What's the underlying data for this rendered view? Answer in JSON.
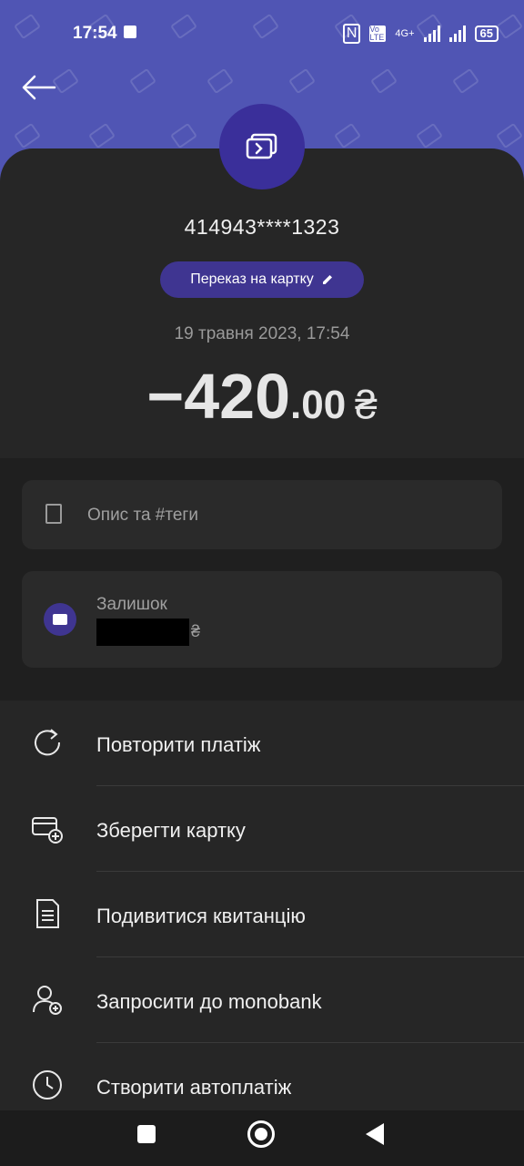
{
  "status_bar": {
    "time": "17:54",
    "network": "4G+",
    "volte": "Vo LTE",
    "battery": "65"
  },
  "transaction": {
    "card_number": "414943****1323",
    "type_label": "Переказ на картку",
    "date": "19 травня 2023, 17:54",
    "amount_main": "−420",
    "amount_cents": ".00",
    "currency": "₴"
  },
  "description": {
    "placeholder": "Опис та #теги"
  },
  "balance": {
    "label": "Залишок",
    "currency": "₴"
  },
  "actions": [
    {
      "label": "Повторити платіж",
      "icon": "repeat-icon"
    },
    {
      "label": "Зберегти картку",
      "icon": "add-card-icon"
    },
    {
      "label": "Подивитися квитанцію",
      "icon": "receipt-icon"
    },
    {
      "label": "Запросити до monobank",
      "icon": "invite-user-icon"
    },
    {
      "label": "Створити автоплатіж",
      "icon": "clock-icon"
    }
  ],
  "colors": {
    "accent": "#5055b4",
    "chip": "#3f3591",
    "background": "#262626"
  }
}
